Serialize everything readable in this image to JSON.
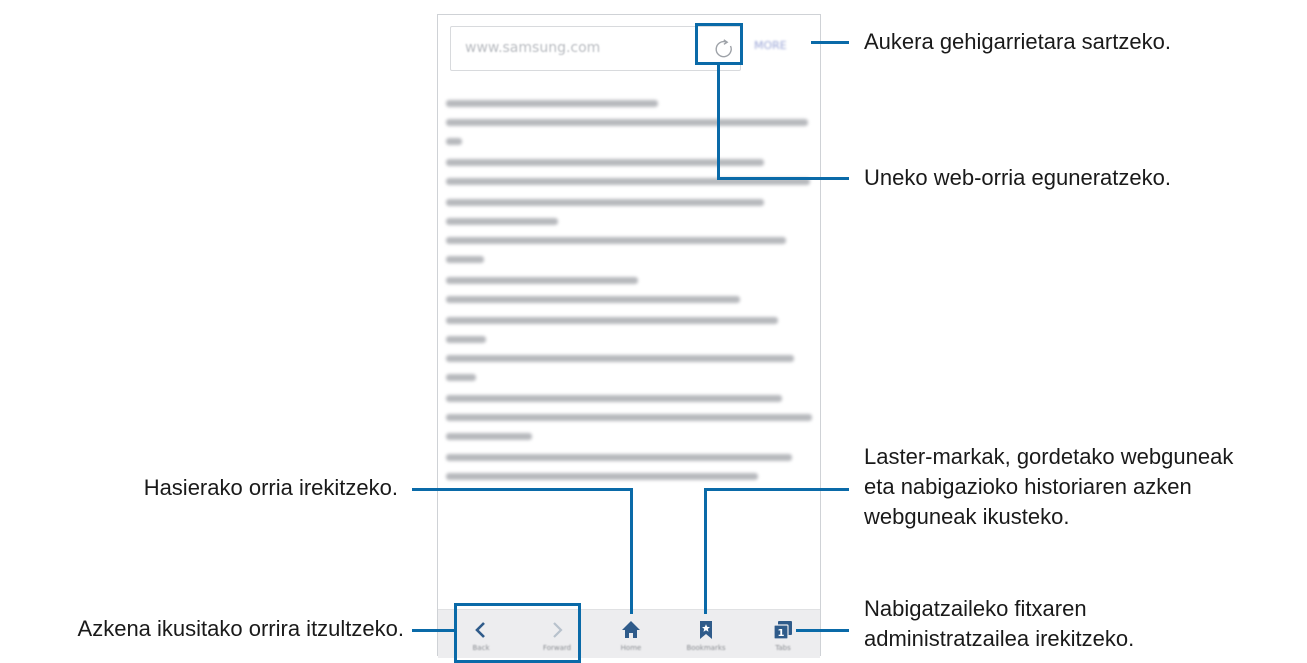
{
  "browser": {
    "url": "www.samsung.com",
    "more_label": "MORE",
    "toolbar": {
      "back_label": "Back",
      "forward_label": "Forward",
      "home_label": "Home",
      "bookmarks_label": "Bookmarks",
      "tabs_label": "Tabs",
      "tabs_count": "1"
    }
  },
  "callouts": {
    "more": "Aukera gehigarrietara sartzeko.",
    "refresh": "Uneko web-orria eguneratzeko.",
    "bookmarks_line1": "Laster-markak, gordetako webguneak",
    "bookmarks_line2": "eta nabigazioko historiaren azken",
    "bookmarks_line3": "webguneak ikusteko.",
    "home": "Hasierako orria irekitzeko.",
    "back": "Azkena ikusitako orrira itzultzeko.",
    "tabs_line1": "Nabigatzaileko fitxaren",
    "tabs_line2": "administratzailea irekitzeko."
  },
  "colors": {
    "callout_blue": "#0a6aa8",
    "toolbar_icon": "#2f5b8a"
  }
}
